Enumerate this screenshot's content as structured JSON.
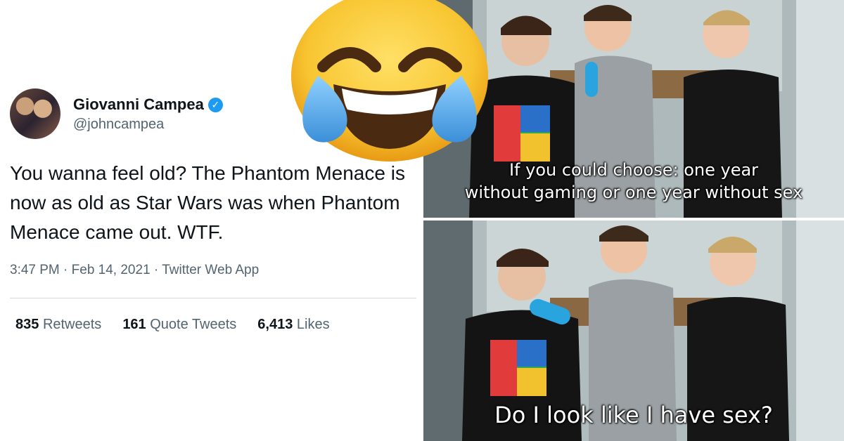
{
  "tweet": {
    "display_name": "Giovanni Campea",
    "handle": "@johncampea",
    "text": "You wanna feel old? The Phantom Menace is now as old as Star Wars was when Phantom Menace came out. WTF.",
    "time": "3:47 PM",
    "date": "Feb 14, 2021",
    "source": "Twitter Web App",
    "retweets_count": "835",
    "retweets_label": "Retweets",
    "quotes_count": "161",
    "quotes_label": "Quote Tweets",
    "likes_count": "6,413",
    "likes_label": "Likes",
    "separator": "·"
  },
  "emoji": {
    "icon": "face-with-tears-of-joy-icon"
  },
  "video": {
    "caption_top_line1": "If you could choose: one year",
    "caption_top_line2": "without gaming or one year without sex",
    "caption_bottom": "Do I look like I have sex?"
  },
  "colors": {
    "verified": "#1d9bf0",
    "secondary_text": "#536471",
    "primary_text": "#0f1419",
    "emoji_yellow": "#f8c531",
    "tear_blue": "#5ab4f0"
  }
}
